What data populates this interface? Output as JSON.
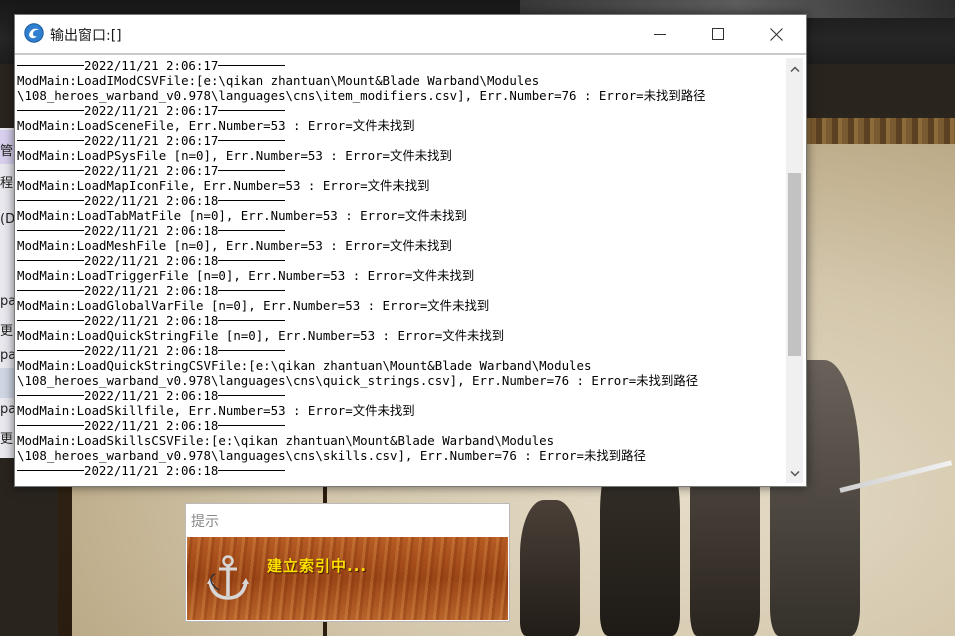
{
  "window": {
    "title": "输出窗口:[]",
    "icon": "app-logo-icon",
    "controls": {
      "minimize": "minimize-icon",
      "maximize": "maximize-icon",
      "close": "close-icon"
    }
  },
  "log": [
    {
      "type": "sep",
      "ts": "2022/11/21 2:06:17"
    },
    {
      "type": "text",
      "text": "ModMain:LoadIModCSVFile:[e:\\qikan zhantuan\\Mount&Blade Warband\\Modules"
    },
    {
      "type": "text",
      "text": "\\108_heroes_warband_v0.978\\languages\\cns\\item_modifiers.csv], Err.Number=76 : Error=未找到路径"
    },
    {
      "type": "sep",
      "ts": "2022/11/21 2:06:17"
    },
    {
      "type": "text",
      "text": "ModMain:LoadSceneFile, Err.Number=53 : Error=文件未找到"
    },
    {
      "type": "sep",
      "ts": "2022/11/21 2:06:17"
    },
    {
      "type": "text",
      "text": "ModMain:LoadPSysFile [n=0], Err.Number=53 : Error=文件未找到"
    },
    {
      "type": "sep",
      "ts": "2022/11/21 2:06:17"
    },
    {
      "type": "text",
      "text": "ModMain:LoadMapIconFile, Err.Number=53 : Error=文件未找到"
    },
    {
      "type": "sep",
      "ts": "2022/11/21 2:06:18"
    },
    {
      "type": "text",
      "text": "ModMain:LoadTabMatFile [n=0], Err.Number=53 : Error=文件未找到"
    },
    {
      "type": "sep",
      "ts": "2022/11/21 2:06:18"
    },
    {
      "type": "text",
      "text": "ModMain:LoadMeshFile [n=0], Err.Number=53 : Error=文件未找到"
    },
    {
      "type": "sep",
      "ts": "2022/11/21 2:06:18"
    },
    {
      "type": "text",
      "text": "ModMain:LoadTriggerFile [n=0], Err.Number=53 : Error=文件未找到"
    },
    {
      "type": "sep",
      "ts": "2022/11/21 2:06:18"
    },
    {
      "type": "text",
      "text": "ModMain:LoadGlobalVarFile [n=0], Err.Number=53 : Error=文件未找到"
    },
    {
      "type": "sep",
      "ts": "2022/11/21 2:06:18"
    },
    {
      "type": "text",
      "text": "ModMain:LoadQuickStringFile [n=0], Err.Number=53 : Error=文件未找到"
    },
    {
      "type": "sep",
      "ts": "2022/11/21 2:06:18"
    },
    {
      "type": "text",
      "text": "ModMain:LoadQuickStringCSVFile:[e:\\qikan zhantuan\\Mount&Blade Warband\\Modules"
    },
    {
      "type": "text",
      "text": "\\108_heroes_warband_v0.978\\languages\\cns\\quick_strings.csv], Err.Number=76 : Error=未找到路径"
    },
    {
      "type": "sep",
      "ts": "2022/11/21 2:06:18"
    },
    {
      "type": "text",
      "text": "ModMain:LoadSkillfile, Err.Number=53 : Error=文件未找到"
    },
    {
      "type": "sep",
      "ts": "2022/11/21 2:06:18"
    },
    {
      "type": "text",
      "text": "ModMain:LoadSkillsCSVFile:[e:\\qikan zhantuan\\Mount&Blade Warband\\Modules"
    },
    {
      "type": "text",
      "text": "\\108_heroes_warband_v0.978\\languages\\cns\\skills.csv], Err.Number=76 : Error=未找到路径"
    },
    {
      "type": "sep",
      "ts": "2022/11/21 2:06:18"
    }
  ],
  "scrollbar": {
    "up_icon": "scroll-up-arrow-icon",
    "down_icon": "scroll-down-arrow-icon",
    "position": 0.47
  },
  "tip": {
    "title": "提示",
    "message": "建立索引中...",
    "icon": "anchor-icon"
  },
  "background_sidebar": [
    "管",
    "程",
    "(D",
    "pa",
    "更",
    "pa",
    "pa",
    "更"
  ],
  "colors": {
    "accent_yellow": "#ffe000",
    "wood": "#a6521c",
    "window_bg": "#ffffff"
  }
}
